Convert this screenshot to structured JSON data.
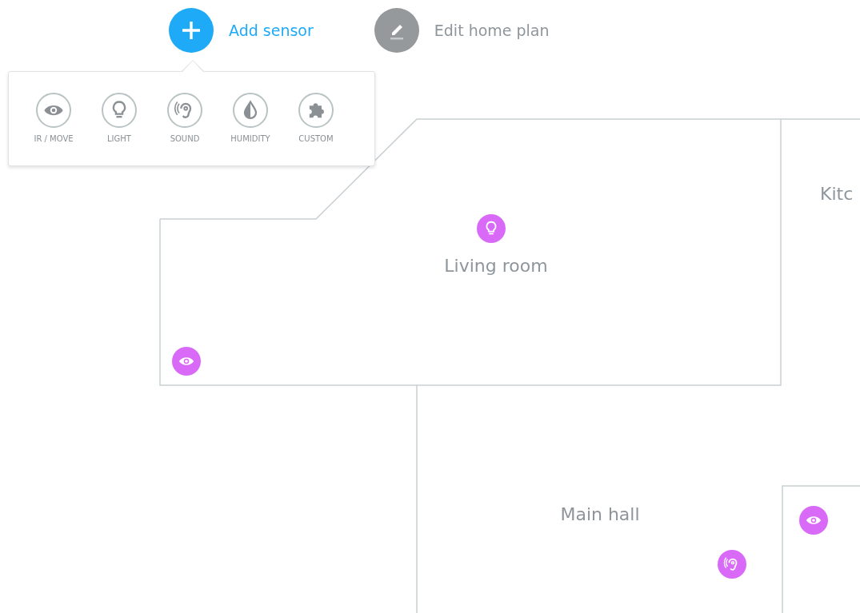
{
  "toolbar": [
    {
      "kind": "add",
      "label": "Add sensor",
      "selected": true
    },
    {
      "kind": "edit",
      "label": "Edit home plan",
      "selected": false
    }
  ],
  "sensor_menu": {
    "items": [
      {
        "kind": "eye",
        "label": "IR / MOVE"
      },
      {
        "kind": "bulb",
        "label": "LIGHT"
      },
      {
        "kind": "ear",
        "label": "SOUND"
      },
      {
        "kind": "drop",
        "label": "HUMIDITY"
      },
      {
        "kind": "puzzle",
        "label": "CUSTOM"
      }
    ]
  },
  "rooms": [
    {
      "name": "Kitc"
    },
    {
      "name": "Living room"
    },
    {
      "name": "Main hall"
    }
  ],
  "sensors": [
    {
      "kind": "bulb"
    },
    {
      "kind": "eye"
    },
    {
      "kind": "eye"
    },
    {
      "kind": "ear"
    }
  ]
}
